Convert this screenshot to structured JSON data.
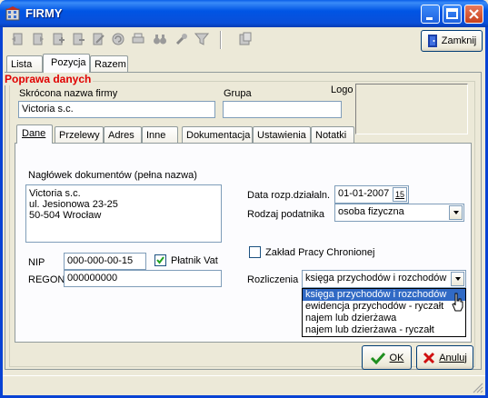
{
  "window": {
    "title": "FIRMY"
  },
  "toolbar": {
    "close_label": "Zamknij",
    "icons": [
      "first-record-icon",
      "prev-record-icon",
      "add-record-icon",
      "delete-record-icon",
      "edit-record-icon",
      "refresh-icon",
      "print-icon",
      "binoculars-icon",
      "tools-icon",
      "filter-icon",
      "export-icon"
    ]
  },
  "main_tabs": [
    "Lista",
    "Pozycja",
    "Razem"
  ],
  "group": {
    "title": "Poprawa danych",
    "short_name_label": "Skrócona nazwa firmy",
    "short_name_value": "Victoria s.c.",
    "group_label": "Grupa",
    "group_value": "",
    "logo_label": "Logo"
  },
  "inner_tabs": [
    "Dane",
    "Przelewy",
    "Adres",
    "Inne",
    "Dokumentacja",
    "Ustawienia",
    "Notatki"
  ],
  "dane": {
    "header_label": "Nagłówek dokumentów (pełna nazwa)",
    "header_lines": [
      "Victoria s.c.",
      "ul. Jesionowa 23-25",
      "50-504 Wrocław"
    ],
    "nip_label": "NIP",
    "nip_value": "000-000-00-15",
    "vat_label": "Płatnik Vat",
    "vat_checked": true,
    "regon_label": "REGON",
    "regon_value": "000000000",
    "start_date_label": "Data rozp.działaln.",
    "start_date_value": "01-01-2007",
    "calendar_label": "15",
    "taxpayer_label": "Rodzaj podatnika",
    "taxpayer_value": "osoba fizyczna",
    "sheltered_label": "Zakład Pracy Chronionej",
    "sheltered_checked": false,
    "settlement_label": "Rozliczenia",
    "settlement_value": "księga przychodów i rozchodów",
    "settlement_options": [
      "księga przychodów i rozchodów",
      "ewidencja przychodów - ryczałt",
      "najem lub dzierżawa",
      "najem lub dzierżawa - ryczałt"
    ]
  },
  "buttons": {
    "ok_label": "OK",
    "cancel_label": "Anuluj"
  }
}
